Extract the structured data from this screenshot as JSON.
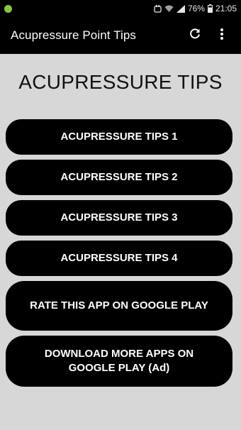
{
  "status_bar": {
    "battery_percent": "76%",
    "time": "21:05",
    "icons": [
      "notification-dot-icon",
      "alarm-icon",
      "wifi-icon",
      "signal-icon",
      "battery-icon"
    ]
  },
  "app_bar": {
    "title": "Acupressure Point Tips",
    "actions": [
      "refresh-icon",
      "overflow-menu-icon"
    ]
  },
  "main": {
    "heading": "ACUPRESSURE TIPS",
    "buttons": [
      "ACUPRESSURE TIPS 1",
      "ACUPRESSURE TIPS 2",
      "ACUPRESSURE TIPS 3",
      "ACUPRESSURE TIPS 4",
      "RATE THIS APP ON GOOGLE PLAY",
      "DOWNLOAD MORE APPS ON GOOGLE PLAY (Ad)"
    ]
  },
  "colors": {
    "background": "#d7d7d7",
    "bars": "#000000",
    "button": "#000000",
    "button_text": "#ffffff",
    "notification_dot": "#8bc34a"
  }
}
